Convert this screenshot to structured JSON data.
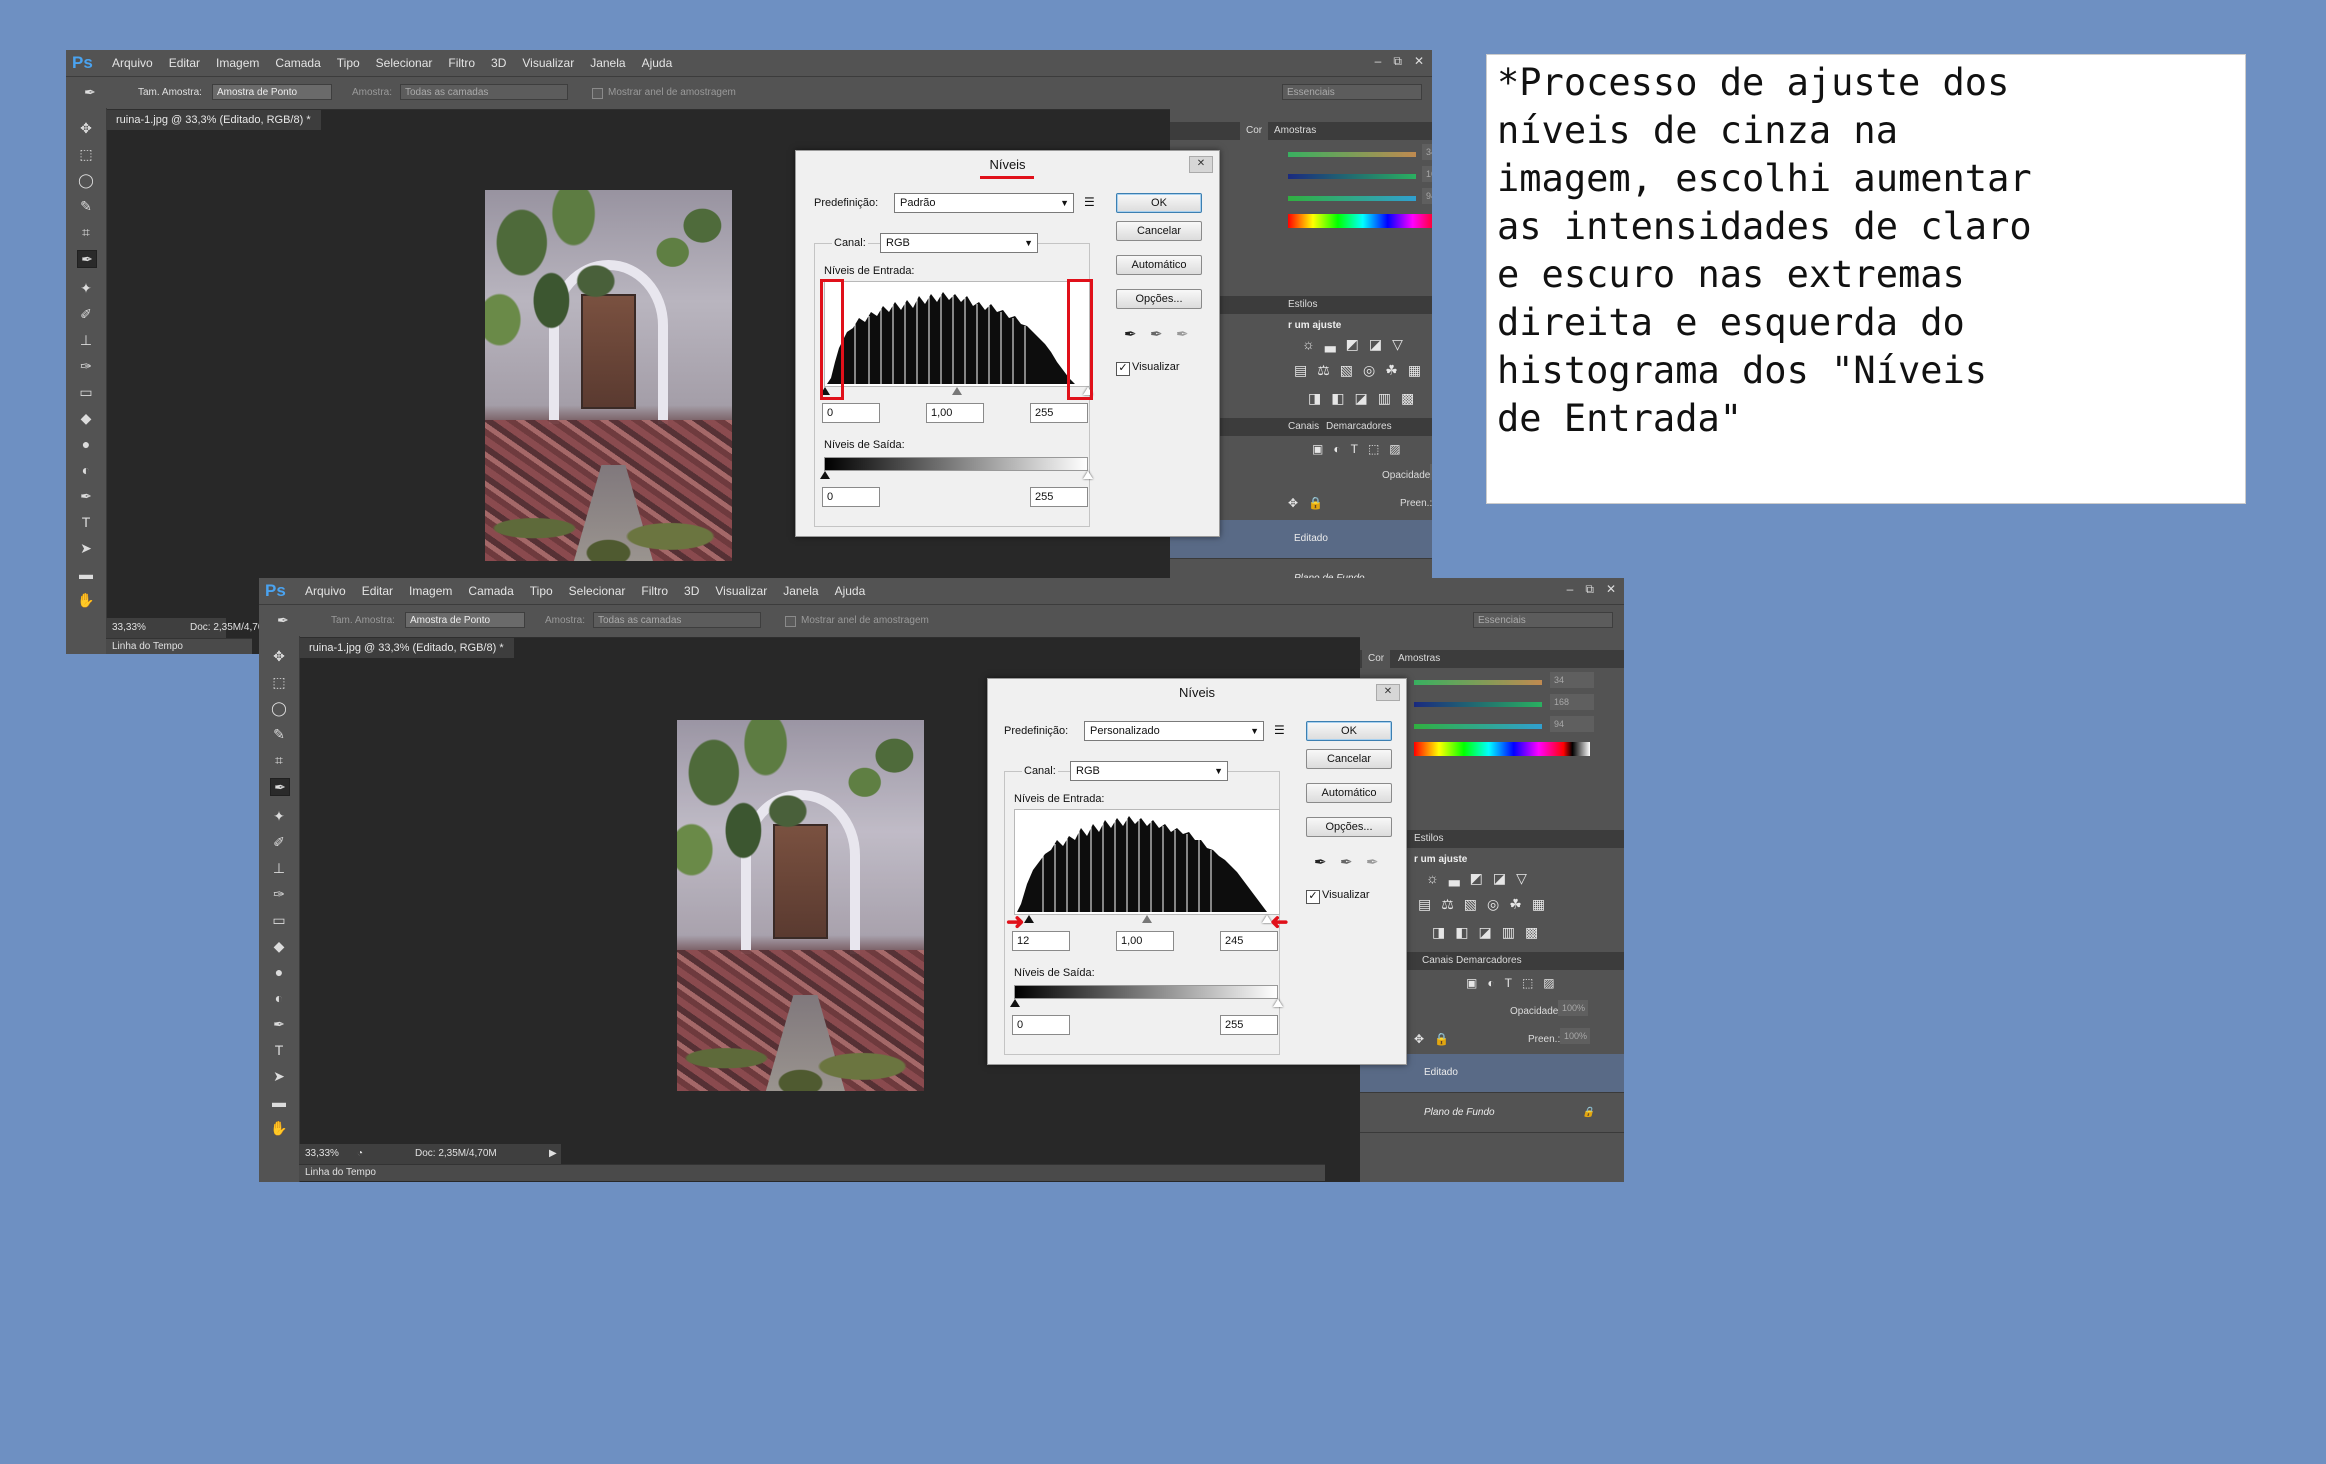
{
  "app": {
    "logo": "Ps",
    "menu": [
      "Arquivo",
      "Editar",
      "Imagem",
      "Camada",
      "Tipo",
      "Selecionar",
      "Filtro",
      "3D",
      "Visualizar",
      "Janela",
      "Ajuda"
    ],
    "window_controls": [
      "–",
      "⧉",
      "✕"
    ]
  },
  "options_bar": {
    "sample_size_label": "Tam. Amostra:",
    "sample_size_value": "Amostra de Ponto",
    "sample_label": "Amostra:",
    "sample_value": "Todas as camadas",
    "ring_label": "Mostrar anel de amostragem",
    "workspace": "Essenciais"
  },
  "document": {
    "tab": "ruina-1.jpg @ 33,3% (Editado, RGB/8) *",
    "zoom": "33,33%",
    "doc_info": "Doc: 2,35M/4,70M",
    "timeline": "Linha do Tempo"
  },
  "panels": {
    "color_tabs": [
      "Cor",
      "Amostras"
    ],
    "color_values": [
      "34",
      "168",
      "94"
    ],
    "adjust_tabs": [
      "Estilos"
    ],
    "adjust_title": "r um ajuste",
    "layers_tabs": [
      "Canais",
      "Demarcadores"
    ],
    "opacity_label": "Opacidade:",
    "opacity_value": "100%",
    "fill_label": "Preen.:",
    "fill_value": "100%",
    "layers": [
      {
        "name": "Editado"
      },
      {
        "name": "Plano de Fundo"
      }
    ]
  },
  "levels_dialog_1": {
    "title": "Níveis",
    "preset_label": "Predefinição:",
    "preset_value": "Padrão",
    "channel_label": "Canal:",
    "channel_value": "RGB",
    "input_levels_label": "Níveis de Entrada:",
    "input_black": "0",
    "input_gamma": "1,00",
    "input_white": "255",
    "output_levels_label": "Níveis de Saída:",
    "output_black": "0",
    "output_white": "255",
    "buttons": {
      "ok": "OK",
      "cancel": "Cancelar",
      "auto": "Automático",
      "options": "Opções..."
    },
    "preview_label": "Visualizar"
  },
  "levels_dialog_2": {
    "title": "Níveis",
    "preset_label": "Predefinição:",
    "preset_value": "Personalizado",
    "channel_label": "Canal:",
    "channel_value": "RGB",
    "input_levels_label": "Níveis de Entrada:",
    "input_black": "12",
    "input_gamma": "1,00",
    "input_white": "245",
    "output_levels_label": "Níveis de Saída:",
    "output_black": "0",
    "output_white": "255",
    "buttons": {
      "ok": "OK",
      "cancel": "Cancelar",
      "auto": "Automático",
      "options": "Opções..."
    },
    "preview_label": "Visualizar"
  },
  "note": {
    "text": "*Processo de ajuste dos\nníveis de cinza na\nimagem, escolhi aumentar\nas intensidades de claro\ne escuro nas extremas\ndireita e esquerda do\nhistograma dos \"Níveis\nde Entrada\""
  }
}
